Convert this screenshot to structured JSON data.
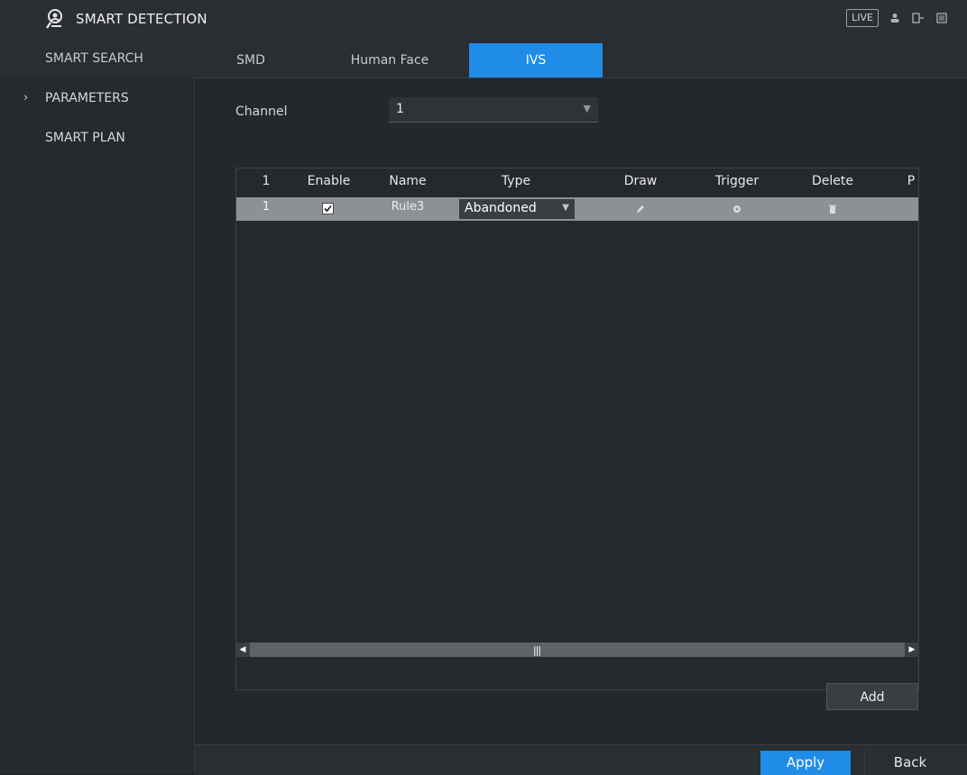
{
  "window": {
    "title": "SMART DETECTION",
    "live_badge": "LIVE"
  },
  "tabs": {
    "search_label": "SMART SEARCH",
    "items": [
      {
        "label": "SMD"
      },
      {
        "label": "Human Face"
      },
      {
        "label": "IVS",
        "active": true
      }
    ]
  },
  "sidebar": {
    "items": [
      {
        "label": "PARAMETERS",
        "selected": true
      },
      {
        "label": "SMART PLAN"
      }
    ]
  },
  "channel": {
    "label": "Channel",
    "value": "1"
  },
  "table": {
    "columns": [
      "1",
      "Enable",
      "Name",
      "Type",
      "Draw",
      "Trigger",
      "Delete",
      "P"
    ],
    "rows": [
      {
        "index": "1",
        "enabled": true,
        "name": "Rule3",
        "type": "Abandoned",
        "draw_icon": "pencil-icon",
        "trigger_icon": "gear-icon",
        "delete_icon": "trash-icon"
      }
    ]
  },
  "scrollbar": {
    "thumb_label": "|||"
  },
  "buttons": {
    "add": "Add",
    "apply": "Apply",
    "back": "Back"
  },
  "colors": {
    "accent": "#1f8de8",
    "row_selected": "#8d9196"
  }
}
